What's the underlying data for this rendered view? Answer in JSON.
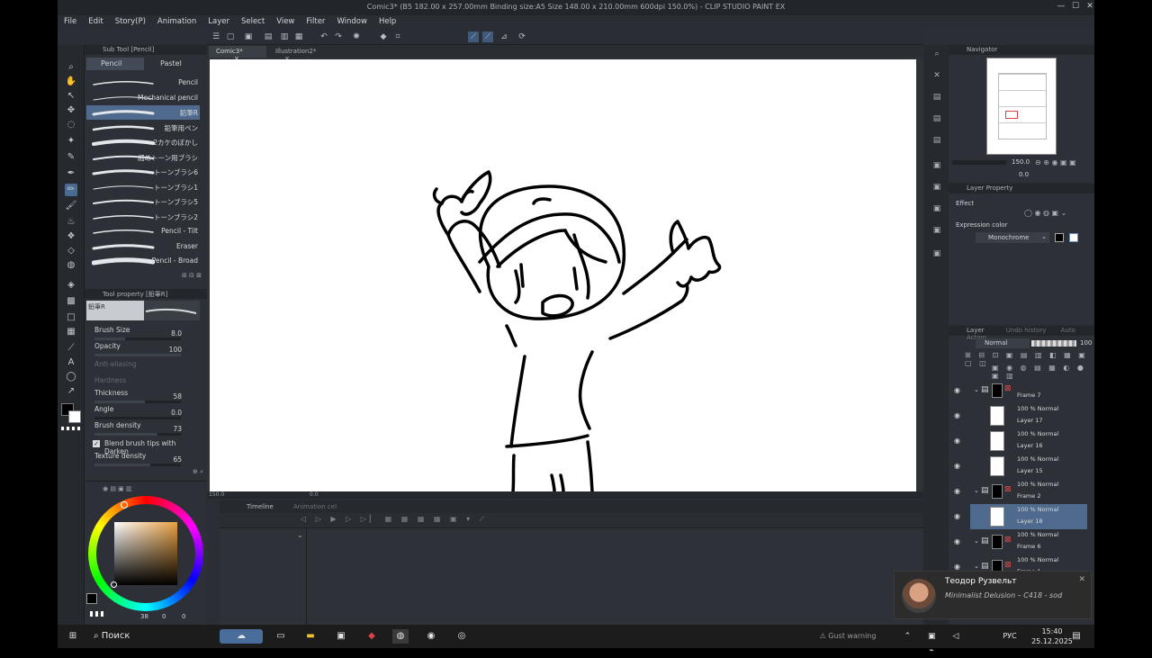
{
  "window": {
    "title": "Comic3* (B5 182.00 x 257.00mm Binding size:A5 Size 148.00 x 210.00mm 600dpi 150.0%) - CLIP STUDIO PAINT EX",
    "controls": [
      "—",
      "☐",
      "✕"
    ]
  },
  "menu": [
    "File",
    "Edit",
    "Story(P)",
    "Animation",
    "Layer",
    "Select",
    "View",
    "Filter",
    "Window",
    "Help"
  ],
  "doc_tabs": [
    {
      "label": "Comic3*",
      "close": "×"
    },
    {
      "label": "Illustration2*",
      "close": "×"
    }
  ],
  "subtool": {
    "header": "Sub Tool [Pencil]",
    "tabs": [
      "Pencil",
      "Pastel"
    ],
    "brushes": [
      "Pencil",
      "Mechanical pencil",
      "鉛筆R",
      "鉛筆用ペン",
      "2カケのぼかし",
      "細めトーン用ブラシ",
      "トーンブラシ6",
      "トーンブラシ1",
      "トーンブラシ5",
      "トーンブラシ2",
      "Pencil - Tilt",
      "Eraser",
      "Pencil - Broad"
    ]
  },
  "toolprop": {
    "header": "Tool property [鉛筆R]",
    "preview_label": "鉛筆R",
    "rows": [
      {
        "label": "Brush Size",
        "value": "8.0",
        "fill": 0.35
      },
      {
        "label": "Opacity",
        "value": "100",
        "fill": 1.0
      },
      {
        "label": "Anti-aliasing",
        "value": "",
        "fill": 0
      },
      {
        "label": "Hardness",
        "value": "",
        "fill": 0
      },
      {
        "label": "Thickness",
        "value": "58",
        "fill": 0.58
      },
      {
        "label": "Angle",
        "value": "0.0",
        "fill": 0
      },
      {
        "label": "Brush density",
        "value": "73",
        "fill": 0.73
      },
      {
        "label": "Blend brush tips with Darken",
        "value": "",
        "fill": 0
      },
      {
        "label": "Texture density",
        "value": "65",
        "fill": 0.65
      }
    ]
  },
  "color": {
    "values": [
      "38",
      "0",
      "0"
    ],
    "main": "#000000",
    "sub": "#ffffff"
  },
  "canvas": {
    "zoom": "150.0",
    "angle": "0.0"
  },
  "timeline": {
    "tab": "Timeline",
    "tab2": "Animation cel"
  },
  "navigator": {
    "header": "Navigator",
    "zoom": "150.0",
    "angle": "0.0"
  },
  "layer_property": {
    "header": "Layer Property",
    "effect": "Effect",
    "expression_label": "Expression color",
    "expression_value": "Monochrome"
  },
  "layers": {
    "header": "Layer",
    "tabs": [
      "Undo history",
      "Auto Action"
    ],
    "blend": "Normal",
    "opacity": "100",
    "items": [
      {
        "l1": "",
        "l2": "Frame 7",
        "type": "folder"
      },
      {
        "l1": "100 % Normal",
        "l2": "Layer 17",
        "type": "layer"
      },
      {
        "l1": "100 % Normal",
        "l2": "Layer 16",
        "type": "layer"
      },
      {
        "l1": "100 % Normal",
        "l2": "Layer 15",
        "type": "layer"
      },
      {
        "l1": "100 % Normal",
        "l2": "Frame 2",
        "type": "folder"
      },
      {
        "l1": "100 % Normal",
        "l2": "Layer 18",
        "type": "layer",
        "selected": true
      },
      {
        "l1": "100 % Normal",
        "l2": "Frame 6",
        "type": "folder"
      },
      {
        "l1": "100 % Normal",
        "l2": "Frame 1",
        "type": "folder"
      }
    ]
  },
  "notification": {
    "name": "Теодор Рузвельт",
    "text": "Minimalist Delusion – C418 - sod",
    "close": "✕"
  },
  "taskbar": {
    "search": "Поиск",
    "weather": "Gust warning",
    "lang": "РУС",
    "time": "15:40",
    "date": "25.12.2025"
  }
}
